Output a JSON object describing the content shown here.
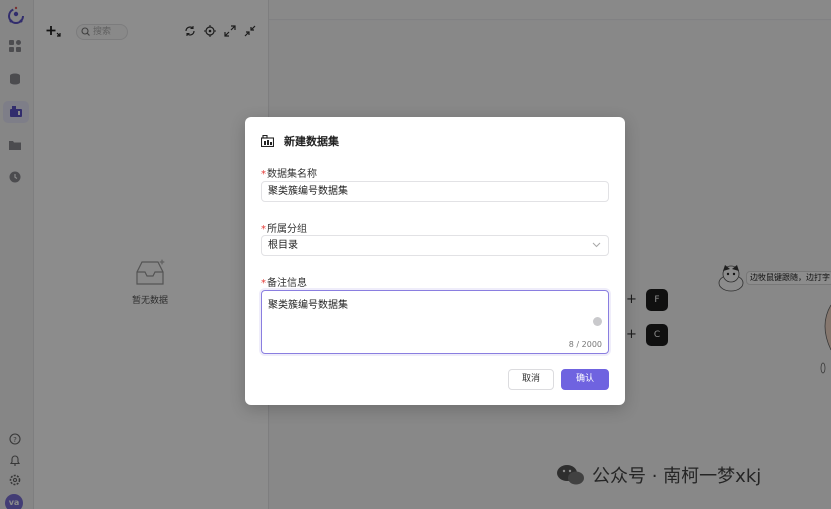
{
  "tree": {
    "search_placeholder": "搜索",
    "empty_label": "暂无数据"
  },
  "rail": {
    "avatar_text": "va"
  },
  "canvas": {
    "shortcut_keys": [
      "F",
      "C"
    ],
    "sticker_text": "边牧鼠键跟随，边打字"
  },
  "watermark": {
    "text": "公众号 · 南柯一梦xkj"
  },
  "modal": {
    "title": "新建数据集",
    "fields": {
      "name": {
        "required_mark": "*",
        "label": "数据集名称",
        "value": "聚类簇编号数据集"
      },
      "group": {
        "required_mark": "*",
        "label": "所属分组",
        "value": "根目录"
      },
      "note": {
        "required_mark": "*",
        "label": "备注信息",
        "value": "聚类簇编号数据集",
        "counter": "8 / 2000"
      }
    },
    "buttons": {
      "cancel": "取消",
      "confirm": "确认"
    }
  },
  "colors": {
    "primary": "#6f63e0",
    "required": "#e53935",
    "overlay": "rgba(0,0,0,0.45)"
  }
}
